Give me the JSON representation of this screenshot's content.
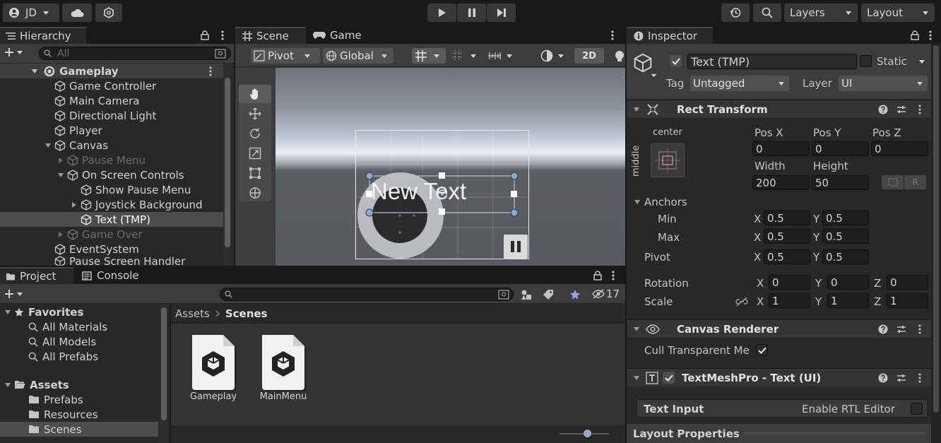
{
  "toolbar": {
    "account": "JD",
    "layers": "Layers",
    "layout": "Layout"
  },
  "hierarchy": {
    "tab": "Hierarchy",
    "search_placeholder": "All",
    "scene": "Gameplay",
    "items": [
      {
        "label": "Game Controller"
      },
      {
        "label": "Main Camera"
      },
      {
        "label": "Directional Light"
      },
      {
        "label": "Player"
      },
      {
        "label": "Canvas"
      },
      {
        "label": "Pause Menu"
      },
      {
        "label": "On Screen Controls"
      },
      {
        "label": "Show Pause Menu"
      },
      {
        "label": "Joystick Background"
      },
      {
        "label": "Text (TMP)"
      },
      {
        "label": "Game Over"
      },
      {
        "label": "EventSystem"
      },
      {
        "label": "Pause Screen Handler"
      }
    ]
  },
  "scene": {
    "tabs": [
      "Scene",
      "Game"
    ],
    "pivot": "Pivot",
    "global": "Global",
    "mode_2d": "2D",
    "text_object": "New Text"
  },
  "project": {
    "tabs": [
      "Project",
      "Console"
    ],
    "hidden_count": "17",
    "favorites": "Favorites",
    "favorite_items": [
      "All Materials",
      "All Models",
      "All Prefabs"
    ],
    "assets": "Assets",
    "asset_folders": [
      "Prefabs",
      "Resources",
      "Scenes"
    ],
    "breadcrumb": [
      "Assets",
      "Scenes"
    ],
    "files": [
      "Gameplay",
      "MainMenu"
    ]
  },
  "inspector": {
    "tab": "Inspector",
    "object_name": "Text (TMP)",
    "static": "Static",
    "tag_label": "Tag",
    "tag_value": "Untagged",
    "layer_label": "Layer",
    "layer_value": "UI",
    "rect_transform": {
      "title": "Rect Transform",
      "anchor_preset_top": "center",
      "anchor_preset_side": "middle",
      "pos_x_label": "Pos X",
      "pos_x": "0",
      "pos_y_label": "Pos Y",
      "pos_y": "0",
      "pos_z_label": "Pos Z",
      "pos_z": "0",
      "width_label": "Width",
      "width": "200",
      "height_label": "Height",
      "height": "50",
      "reset_btn": "R",
      "anchors_label": "Anchors",
      "min_label": "Min",
      "min_x": "0.5",
      "min_y": "0.5",
      "max_label": "Max",
      "max_x": "0.5",
      "max_y": "0.5",
      "pivot_label": "Pivot",
      "pivot_x": "0.5",
      "pivot_y": "0.5",
      "rotation_label": "Rotation",
      "rot_x": "0",
      "rot_y": "0",
      "rot_z": "0",
      "scale_label": "Scale",
      "scale_x": "1",
      "scale_y": "1",
      "scale_z": "1",
      "x": "X",
      "y": "Y",
      "z": "Z"
    },
    "canvas_renderer": {
      "title": "Canvas Renderer",
      "cull_label": "Cull Transparent Me"
    },
    "tmp": {
      "title": "TextMeshPro - Text (UI)",
      "text_input": "Text Input",
      "rtl": "Enable RTL Editor"
    },
    "layout_properties": "Layout Properties"
  }
}
